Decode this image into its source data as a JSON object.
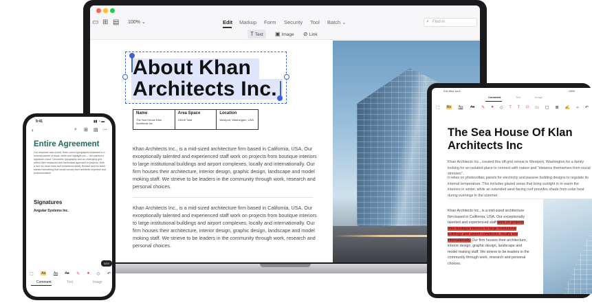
{
  "laptop": {
    "toolbar": {
      "zoom": "100%",
      "zoom_caret": "⌄",
      "menu": [
        "Edit",
        "Markup",
        "Form",
        "Security",
        "Tool",
        "Batch"
      ],
      "batch_caret": "⌄",
      "search_placeholder": "Find in",
      "sub_tools": [
        {
          "label": "Text",
          "icon": "T"
        },
        {
          "label": "Image",
          "icon": "▣"
        },
        {
          "label": "Link",
          "icon": "⊘"
        }
      ]
    },
    "document": {
      "title_line1": "About Khan",
      "title_line2": "Architects Inc.",
      "table": {
        "headers": [
          "Name",
          "Area Space",
          "Location"
        ],
        "values": [
          "The Sea House Klan Architects Inc",
          "150oft Total",
          "Westport, Washington, USA"
        ]
      },
      "paragraph1": "Khan Architects Inc., is a mid-sized architecture firm based in California, USA. Our exceptionally talented and experienced staff work on projects from boutique interiors to large institutional buildings and airport complexes, locally and internationally. Our firm houses their architecture, interior design, graphic design, landscape and model moking staff. We strieve to be leaders in the community through work, research and personal choices.",
      "paragraph2": "Khan Architects Inc., is a mid-sized architecture firm based in California, USA. Our exceptionally talented and experienced staff work on projects from boutique interiors to large institutional buildings and airport complexes, locally and internationally. Our firm houses their architecture, interior design, graphic design, landscape and model moking staff. We strieve to be leaders in the community through work, research and personal choices."
    }
  },
  "phone": {
    "status_time": "9:41",
    "status_icons": "▮▮ ◔ ▬",
    "heading": "Entire Agreement",
    "body": "Our response was a bold, three colour typographic treatment in a minimal palette of black, white and highlight red — the practice's signature colour. Geometric typography and an underlying grid reflect their measured and methodical approach to projects. With a love for clean lines and considered detail, Richard and his team wanted something that would convey their aesthetic expertise and professionalism.",
    "signatures": "Signatures",
    "company": "Angular Systems Inc.",
    "page_badge": "3/24",
    "tabs": [
      "Comment",
      "Text",
      "Image"
    ]
  },
  "tablet": {
    "status_time": "9:41",
    "status_date": "Wed Jun 8",
    "status_right": "100%",
    "tabs": [
      "Comment",
      "Text",
      "Image"
    ],
    "title": "The Sea House Of Klan Architects Inc",
    "para1": "Khan Architects Inc., created this off-grid retreat in Westport, Washington for a family looking for an isolated place to connect with nature and \"distance themselves from social stresses\".",
    "para2": "It relies on photovoltaic panels for electricity and passive building designs to regulate its internal temperature. This includes glazed areas that bring sunlight in to warm the interiors in winter, while an extended west-facing roof provides shade from solar heat during evenings in the summer.",
    "col_before": "Khan Architects Inc., is a mid-sized architecture firm based in California, USA. Our exceptionally talented and experienced staff",
    "col_highlight": "work on projects from boutique interiors to large institutional buildings and airport complexes, locally and internationally.",
    "col_after": "Our firm houses their architecture, interior design, graphic design, landscape and model making staff. We strieve to be leaders in the community through work, research and personal choices."
  },
  "colors": {
    "accent_blue": "#3d63d6",
    "heading_green": "#1f6b5c",
    "highlight_red": "#e84b45",
    "highlight_yellow": "#f6d46b"
  }
}
